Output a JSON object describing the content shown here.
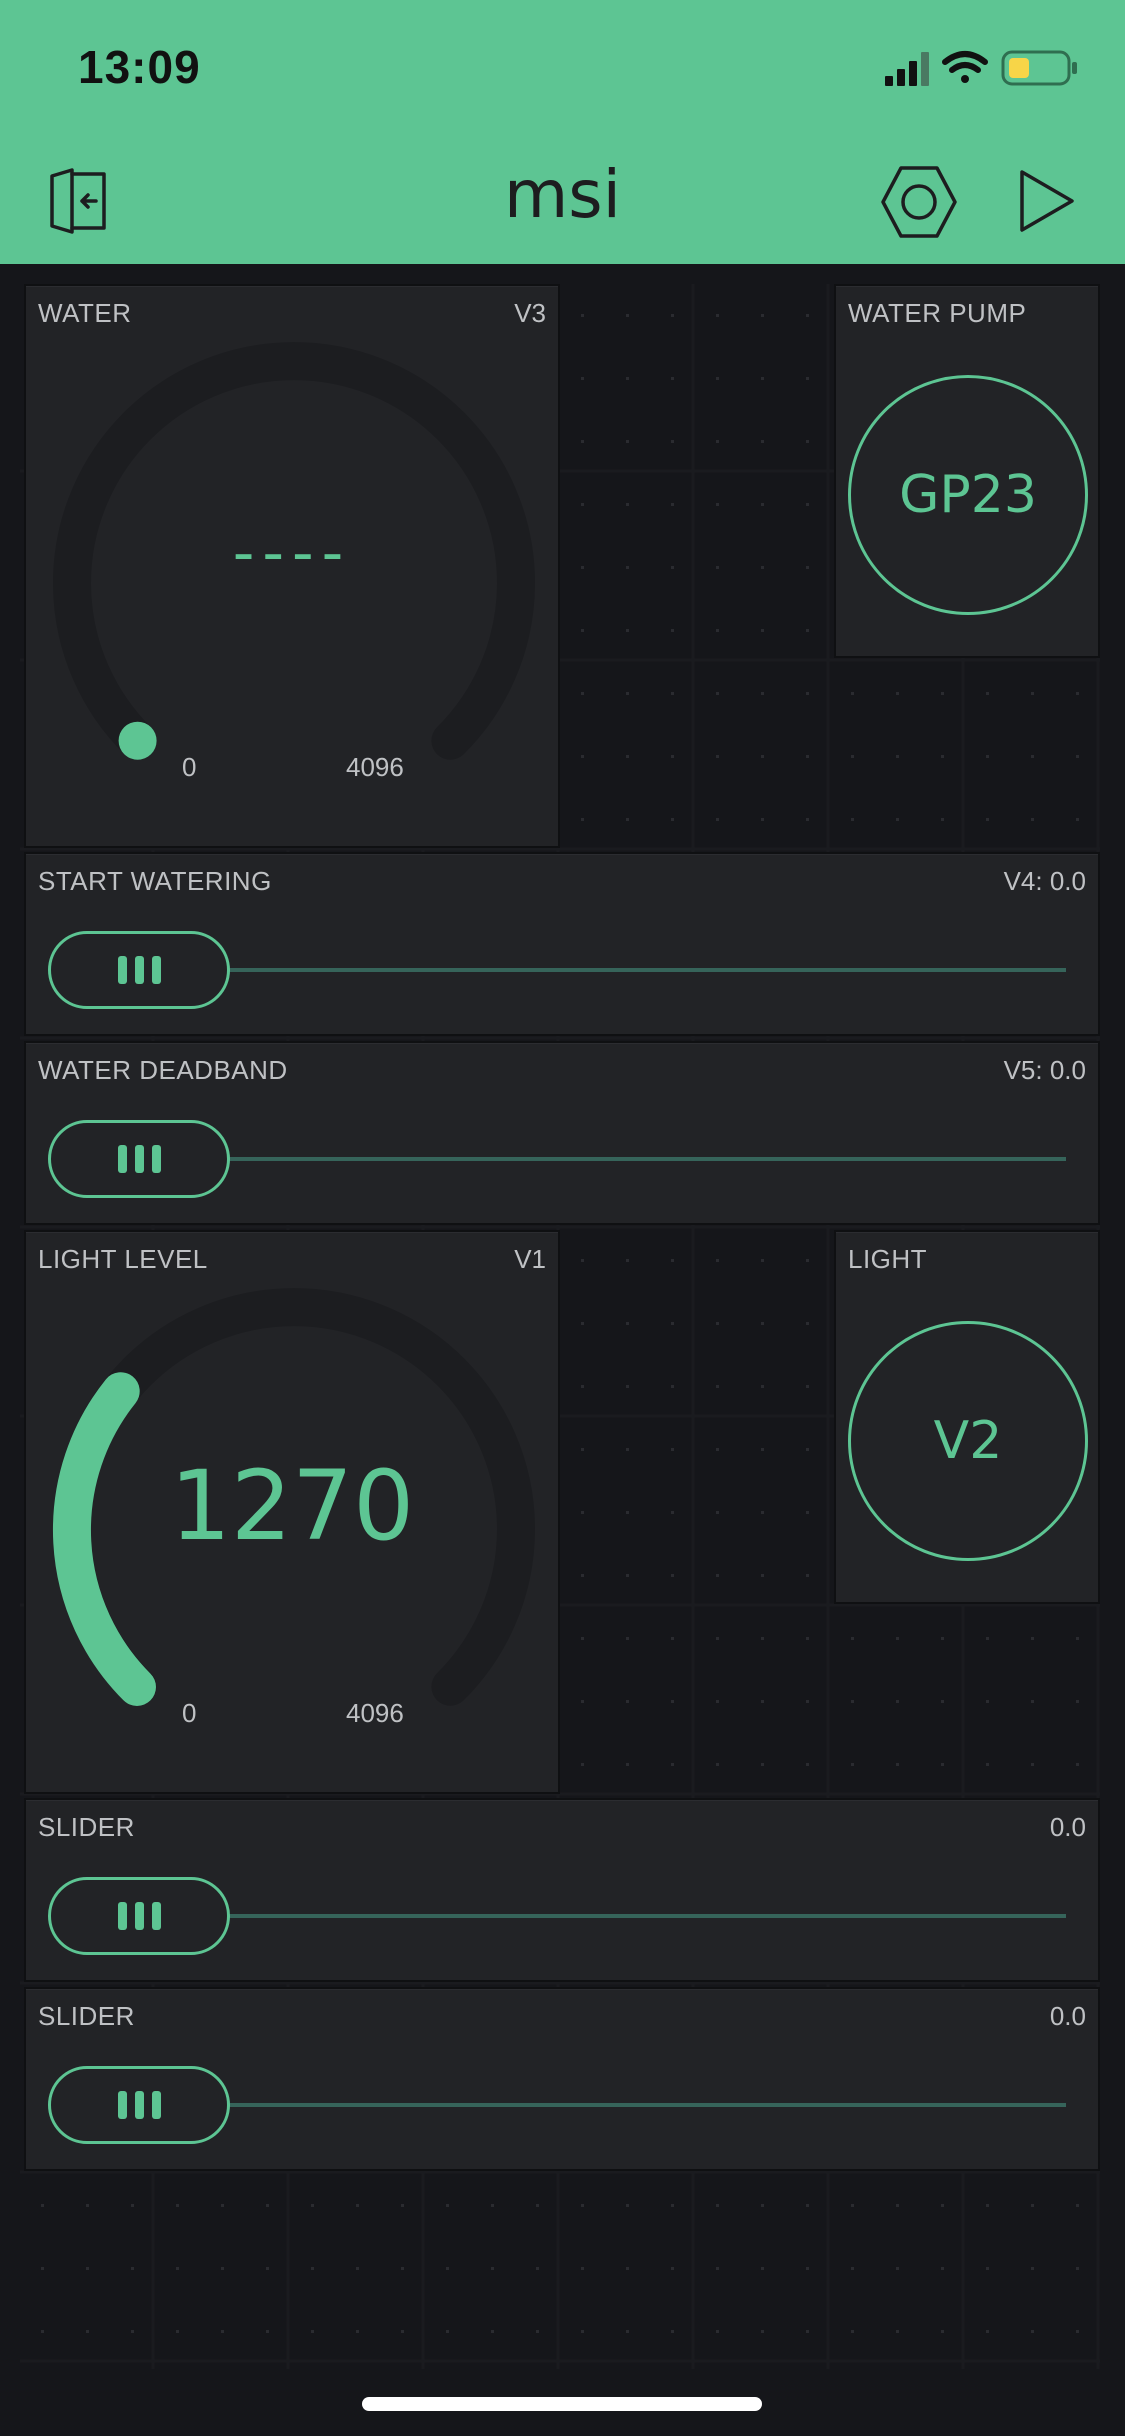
{
  "status_bar": {
    "time": "13:09",
    "icons": [
      "signal-icon",
      "wifi-icon",
      "battery-icon"
    ]
  },
  "header": {
    "title": "msi",
    "left_button": "exit-icon",
    "right_buttons": [
      "settings-icon",
      "play-icon"
    ]
  },
  "colors": {
    "accent": "#5dc593",
    "panel": "#222326",
    "background": "#15161a",
    "text": "#bfc1c4"
  },
  "widgets": {
    "water": {
      "label": "WATER",
      "pin": "V3",
      "value": "----",
      "min": "0",
      "max": "4096",
      "level": 0
    },
    "water_pump": {
      "label": "WATER PUMP",
      "button": "GP23"
    },
    "start_watering": {
      "label": "START WATERING",
      "value": "V4: 0.0",
      "level": 0
    },
    "water_deadband": {
      "label": "WATER DEADBAND",
      "value": "V5: 0.0",
      "level": 0
    },
    "light_level": {
      "label": "LIGHT LEVEL",
      "pin": "V1",
      "value": "1270",
      "min": "0",
      "max": "4096",
      "level": 0.31
    },
    "light": {
      "label": "LIGHT",
      "button": "V2"
    },
    "slider_1": {
      "label": "SLIDER",
      "value": "0.0",
      "level": 0
    },
    "slider_2": {
      "label": "SLIDER",
      "value": "0.0",
      "level": 0
    }
  }
}
